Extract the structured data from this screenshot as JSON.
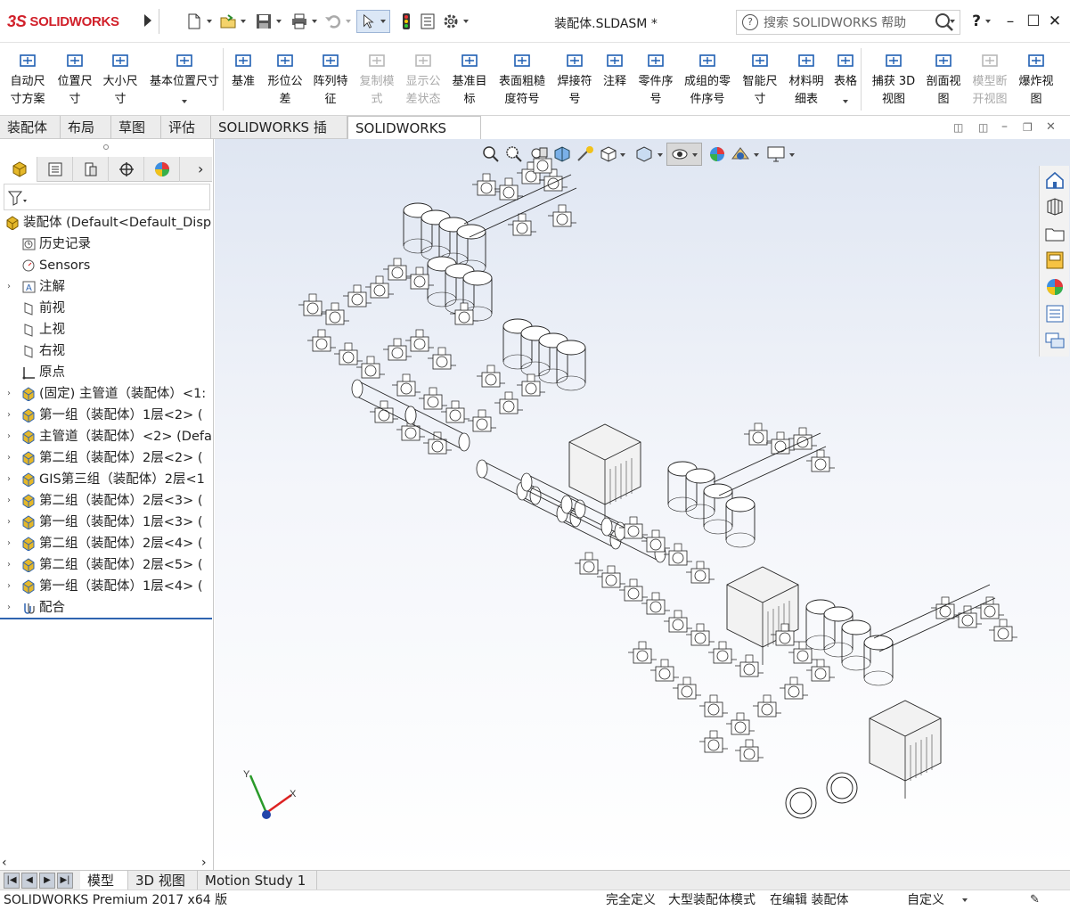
{
  "app": {
    "brand": "SOLIDWORKS",
    "doc_title": "装配体.SLDASM *",
    "search_placeholder": "搜索 SOLIDWORKS 帮助",
    "help_label": "?"
  },
  "command_bar": [
    {
      "label": "自动尺\n寸方案",
      "enabled": true,
      "icon": "auto-dimension-icon"
    },
    {
      "label": "位置尺\n寸",
      "enabled": true,
      "icon": "location-dimension-icon"
    },
    {
      "label": "大小尺\n寸",
      "enabled": true,
      "icon": "size-dimension-icon"
    },
    {
      "label": "基本位置尺寸",
      "enabled": true,
      "icon": "basic-location-dimension-icon"
    },
    {
      "label": "基准",
      "enabled": true,
      "icon": "datum-icon"
    },
    {
      "label": "形位公\n差",
      "enabled": true,
      "icon": "geometric-tolerance-icon"
    },
    {
      "label": "阵列特\n征",
      "enabled": true,
      "icon": "pattern-feature-icon"
    },
    {
      "label": "复制模\n式",
      "enabled": false,
      "icon": "copy-scheme-icon"
    },
    {
      "label": "显示公\n差状态",
      "enabled": false,
      "icon": "show-tolerance-status-icon"
    },
    {
      "label": "基准目\n标",
      "enabled": true,
      "icon": "datum-target-icon"
    },
    {
      "label": "表面粗糙\n度符号",
      "enabled": true,
      "icon": "surface-finish-icon"
    },
    {
      "label": "焊接符\n号",
      "enabled": true,
      "icon": "weld-symbol-icon"
    },
    {
      "label": "注释",
      "enabled": true,
      "icon": "note-icon"
    },
    {
      "label": "零件序\n号",
      "enabled": true,
      "icon": "balloon-icon"
    },
    {
      "label": "成组的零\n件序号",
      "enabled": true,
      "icon": "stacked-balloon-icon"
    },
    {
      "label": "智能尺\n寸",
      "enabled": true,
      "icon": "smart-dimension-icon"
    },
    {
      "label": "材料明\n细表",
      "enabled": true,
      "icon": "bom-icon"
    },
    {
      "label": "表格",
      "enabled": true,
      "icon": "table-icon"
    },
    {
      "label": "捕获 3D\n视图",
      "enabled": true,
      "icon": "capture-3d-view-icon"
    },
    {
      "label": "剖面视\n图",
      "enabled": true,
      "icon": "section-view-icon"
    },
    {
      "label": "模型断\n开视图",
      "enabled": false,
      "icon": "model-break-view-icon"
    },
    {
      "label": "爆炸视\n图",
      "enabled": true,
      "icon": "exploded-view-icon"
    }
  ],
  "tabs": [
    {
      "label": "装配体",
      "active": false
    },
    {
      "label": "布局",
      "active": false
    },
    {
      "label": "草图",
      "active": false
    },
    {
      "label": "评估",
      "active": false
    },
    {
      "label": "SOLIDWORKS 插件",
      "active": false
    },
    {
      "label": "SOLIDWORKS MBD",
      "active": true
    }
  ],
  "tree": [
    {
      "label": "装配体  (Default<Default_Disp",
      "expander": "",
      "icon": "assembly-icon"
    },
    {
      "label": "历史记录",
      "expander": "",
      "icon": "history-icon"
    },
    {
      "label": "Sensors",
      "expander": "",
      "icon": "sensors-icon"
    },
    {
      "label": "注解",
      "expander": "›",
      "icon": "annotations-icon"
    },
    {
      "label": "前视",
      "expander": "",
      "icon": "plane-icon"
    },
    {
      "label": "上视",
      "expander": "",
      "icon": "plane-icon"
    },
    {
      "label": "右视",
      "expander": "",
      "icon": "plane-icon"
    },
    {
      "label": "原点",
      "expander": "",
      "icon": "origin-icon"
    },
    {
      "label": "(固定) 主管道（装配体）<1:",
      "expander": "›",
      "icon": "subassembly-icon"
    },
    {
      "label": "第一组（装配体）1层<2> (",
      "expander": "›",
      "icon": "subassembly-icon"
    },
    {
      "label": "主管道（装配体）<2> (Defa",
      "expander": "›",
      "icon": "subassembly-icon"
    },
    {
      "label": "第二组（装配体）2层<2> (",
      "expander": "›",
      "icon": "subassembly-icon"
    },
    {
      "label": "GIS第三组（装配体）2层<1",
      "expander": "›",
      "icon": "subassembly-icon"
    },
    {
      "label": "第二组（装配体）2层<3> (",
      "expander": "›",
      "icon": "subassembly-icon"
    },
    {
      "label": "第一组（装配体）1层<3> (",
      "expander": "›",
      "icon": "subassembly-icon"
    },
    {
      "label": "第二组（装配体）2层<4> (",
      "expander": "›",
      "icon": "subassembly-icon"
    },
    {
      "label": "第二组（装配体）2层<5> (",
      "expander": "›",
      "icon": "subassembly-icon"
    },
    {
      "label": "第一组（装配体）1层<4> (",
      "expander": "›",
      "icon": "subassembly-icon"
    },
    {
      "label": "配合",
      "expander": "›",
      "icon": "mates-icon"
    }
  ],
  "bottom_tabs": [
    {
      "label": "模型",
      "active": true
    },
    {
      "label": "3D 视图",
      "active": false
    },
    {
      "label": "Motion Study 1",
      "active": false
    }
  ],
  "status": {
    "product": "SOLIDWORKS Premium 2017 x64 版",
    "definition": "完全定义",
    "mode": "大型装配体模式",
    "editing": "在编辑 装配体",
    "units": "自定义"
  },
  "triad": {
    "x": "X",
    "y": "Y"
  },
  "colors": {
    "brand_red": "#d1202a",
    "accent_blue": "#2f64b0",
    "component_yellow": "#e5b82a"
  }
}
